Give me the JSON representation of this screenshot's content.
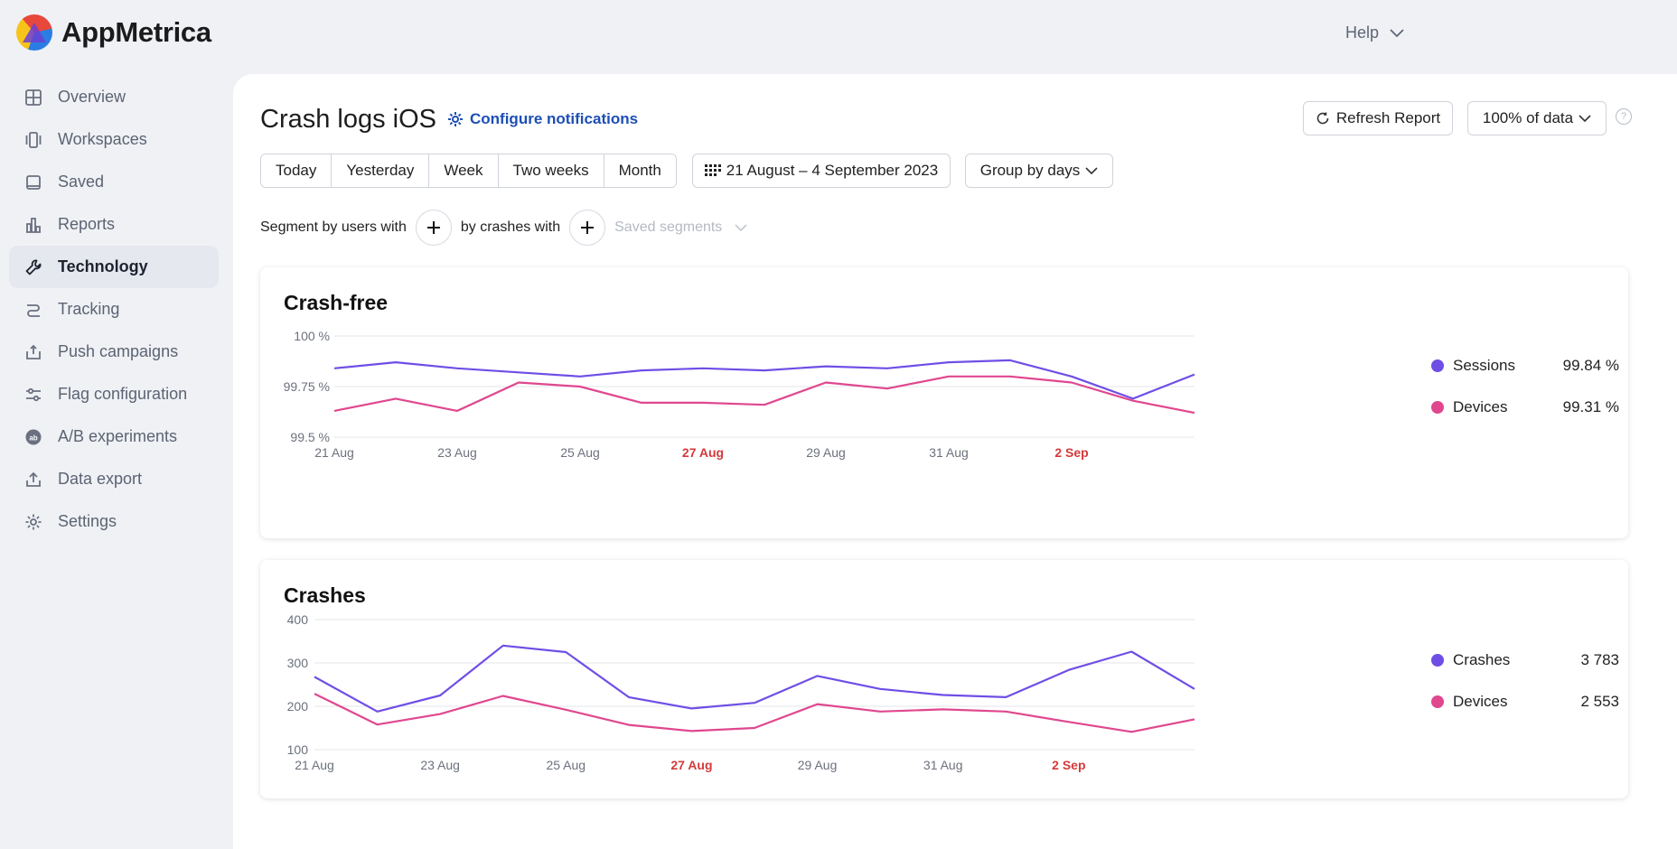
{
  "app": {
    "name": "AppMetrica",
    "help_label": "Help"
  },
  "sidebar": {
    "items": [
      {
        "label": "Overview",
        "icon": "grid-icon"
      },
      {
        "label": "Workspaces",
        "icon": "workspaces-icon"
      },
      {
        "label": "Saved",
        "icon": "saved-icon"
      },
      {
        "label": "Reports",
        "icon": "reports-icon"
      },
      {
        "label": "Technology",
        "icon": "wrench-icon",
        "active": true
      },
      {
        "label": "Tracking",
        "icon": "tracking-icon"
      },
      {
        "label": "Push campaigns",
        "icon": "push-icon"
      },
      {
        "label": "Flag configuration",
        "icon": "sliders-icon"
      },
      {
        "label": "A/B experiments",
        "icon": "ab-icon"
      },
      {
        "label": "Data export",
        "icon": "export-icon"
      },
      {
        "label": "Settings",
        "icon": "gear-icon"
      }
    ]
  },
  "header": {
    "title": "Crash logs iOS",
    "configure_label": "Configure notifications",
    "refresh_label": "Refresh Report",
    "data_label": "100% of data",
    "help_mark": "?"
  },
  "filters": {
    "periods": [
      "Today",
      "Yesterday",
      "Week",
      "Two weeks",
      "Month"
    ],
    "date_range": "21 August – 4 September 2023",
    "group_by": "Group by days",
    "segment_users_label": "Segment by users with",
    "segment_crashes_label": "by crashes with",
    "saved_segments_label": "Saved segments"
  },
  "colors": {
    "series_a": "#6f4ee6",
    "series_b": "#e0478f",
    "weekend": "#d43a3a"
  },
  "chart_data": [
    {
      "type": "line",
      "title": "Crash-free",
      "x": [
        "21 Aug",
        "22 Aug",
        "23 Aug",
        "24 Aug",
        "25 Aug",
        "26 Aug",
        "27 Aug",
        "28 Aug",
        "29 Aug",
        "30 Aug",
        "31 Aug",
        "1 Sep",
        "2 Sep",
        "3 Sep",
        "4 Sep"
      ],
      "x_tick_labels": [
        "21 Aug",
        "23 Aug",
        "25 Aug",
        "27 Aug",
        "29 Aug",
        "31 Aug",
        "2 Sep"
      ],
      "x_tick_highlight": [
        "27 Aug",
        "2 Sep"
      ],
      "y_tick_labels": [
        "100 %",
        "99.75 %",
        "99.5 %"
      ],
      "ylim": [
        99.5,
        100
      ],
      "grid": true,
      "series": [
        {
          "name": "Sessions",
          "summary": "99.84 %",
          "values": [
            99.84,
            99.87,
            99.84,
            99.82,
            99.8,
            99.83,
            99.84,
            99.83,
            99.85,
            99.84,
            99.87,
            99.88,
            99.8,
            99.69,
            99.81
          ]
        },
        {
          "name": "Devices",
          "summary": "99.31 %",
          "values": [
            99.63,
            99.69,
            99.63,
            99.77,
            99.75,
            99.67,
            99.67,
            99.66,
            99.77,
            99.74,
            99.8,
            99.8,
            99.77,
            99.68,
            99.62
          ]
        }
      ]
    },
    {
      "type": "line",
      "title": "Crashes",
      "x": [
        "21 Aug",
        "22 Aug",
        "23 Aug",
        "24 Aug",
        "25 Aug",
        "26 Aug",
        "27 Aug",
        "28 Aug",
        "29 Aug",
        "30 Aug",
        "31 Aug",
        "1 Sep",
        "2 Sep",
        "3 Sep",
        "4 Sep"
      ],
      "x_tick_labels": [
        "21 Aug",
        "23 Aug",
        "25 Aug",
        "27 Aug",
        "29 Aug",
        "31 Aug",
        "2 Sep"
      ],
      "x_tick_highlight": [
        "27 Aug",
        "2 Sep"
      ],
      "y_tick_labels": [
        "400",
        "300",
        "200",
        "100"
      ],
      "ylim": [
        100,
        400
      ],
      "grid": true,
      "series": [
        {
          "name": "Crashes",
          "summary": "3 783",
          "values": [
            268,
            188,
            225,
            340,
            325,
            221,
            195,
            208,
            270,
            240,
            226,
            221,
            284,
            326,
            240
          ]
        },
        {
          "name": "Devices",
          "summary": "2 553",
          "values": [
            229,
            158,
            182,
            224,
            192,
            157,
            143,
            150,
            205,
            188,
            193,
            188,
            164,
            141,
            170
          ]
        }
      ]
    }
  ]
}
